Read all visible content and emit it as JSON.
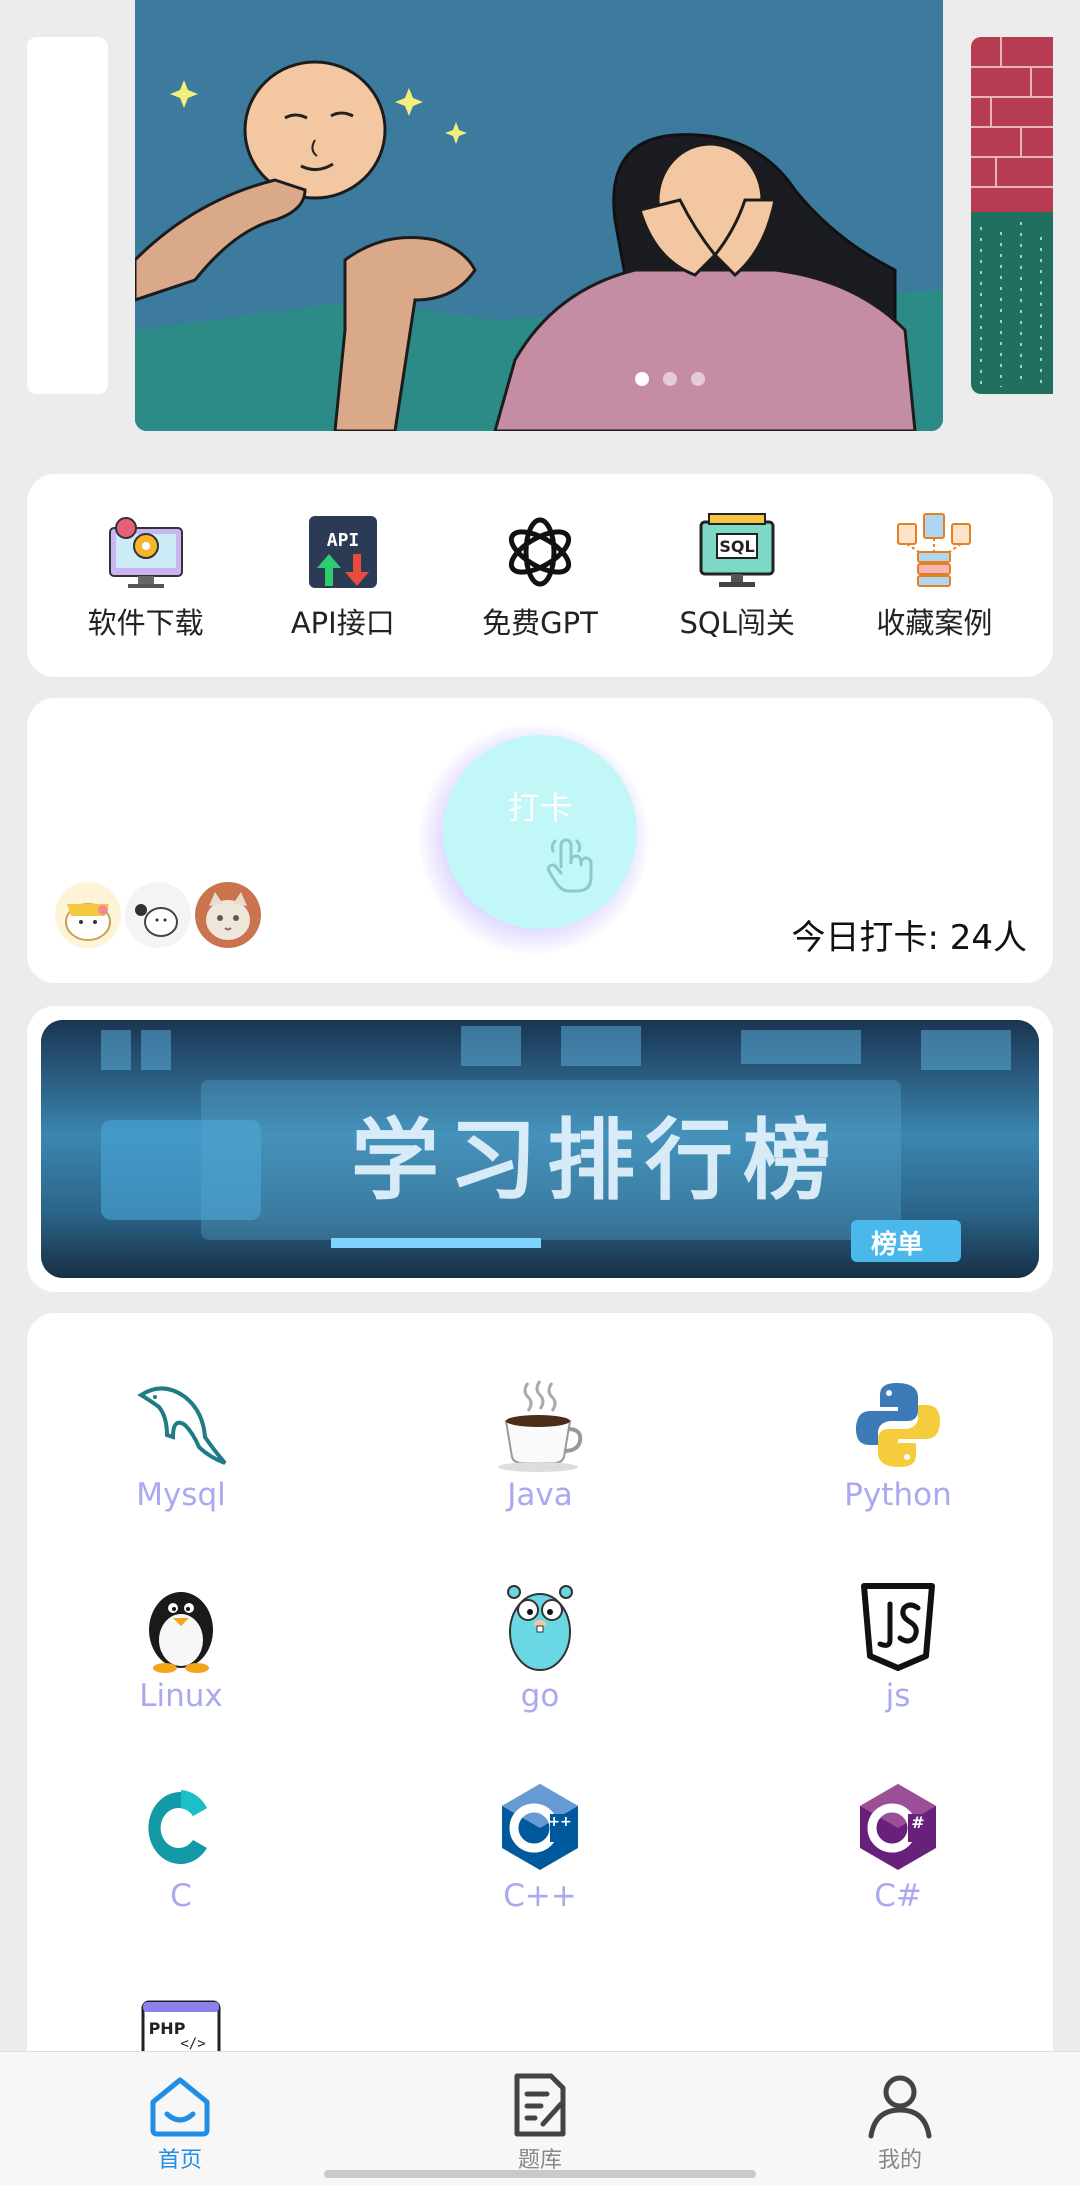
{
  "carousel": {
    "slide_count": 3,
    "active_index": 0
  },
  "quick_menu": [
    {
      "label": "软件下载",
      "icon": "software-download-icon"
    },
    {
      "label": "API接口",
      "icon": "api-icon"
    },
    {
      "label": "免费GPT",
      "icon": "openai-icon"
    },
    {
      "label": "SQL闯关",
      "icon": "sql-icon"
    },
    {
      "label": "收藏案例",
      "icon": "collection-icon"
    }
  ],
  "checkin": {
    "button_label": "打卡",
    "count_text": "今日打卡: 24人"
  },
  "leaderboard": {
    "banner_text": "学习排行榜",
    "badge_text": "榜单"
  },
  "languages": [
    {
      "label": "Mysql"
    },
    {
      "label": "Java"
    },
    {
      "label": "Python"
    },
    {
      "label": "Linux"
    },
    {
      "label": "go"
    },
    {
      "label": "js"
    },
    {
      "label": "C"
    },
    {
      "label": "C++"
    },
    {
      "label": "C#"
    },
    {
      "label": ""
    }
  ],
  "tabbar": [
    {
      "label": "首页",
      "icon": "home-icon",
      "active": true
    },
    {
      "label": "题库",
      "icon": "question-bank-icon",
      "active": false
    },
    {
      "label": "我的",
      "icon": "user-icon",
      "active": false
    }
  ],
  "colors": {
    "accent": "#1f8ee6",
    "lang_label": "#a8a9f0",
    "checkin_button": "#c1f7f7"
  }
}
